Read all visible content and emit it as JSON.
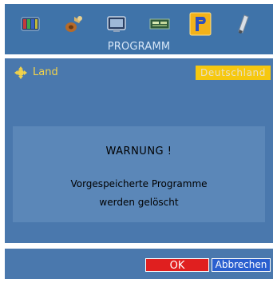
{
  "menu": {
    "title": "PROGRAMM",
    "icons": [
      {
        "name": "picture-icon",
        "selected": false
      },
      {
        "name": "sound-icon",
        "selected": false
      },
      {
        "name": "screen-icon",
        "selected": false
      },
      {
        "name": "features-icon",
        "selected": false
      },
      {
        "name": "program-icon",
        "selected": true
      },
      {
        "name": "setup-icon",
        "selected": false
      }
    ]
  },
  "settings": {
    "land_label": "Land",
    "land_value": "Deutschland"
  },
  "warning": {
    "title": "WARNUNG !",
    "line1": "Vorgespeicherte Programme",
    "line2": "werden gelöscht"
  },
  "buttons": {
    "ok_label": "OK",
    "cancel_label": "Abbrechen"
  },
  "colors": {
    "menu_bg": "#3f73a9",
    "panel_bg": "#4a78ad",
    "warning_bg": "#5b87b8",
    "highlight": "#f6c80f",
    "ok": "#e01f1f",
    "cancel": "#2a5fcf"
  }
}
